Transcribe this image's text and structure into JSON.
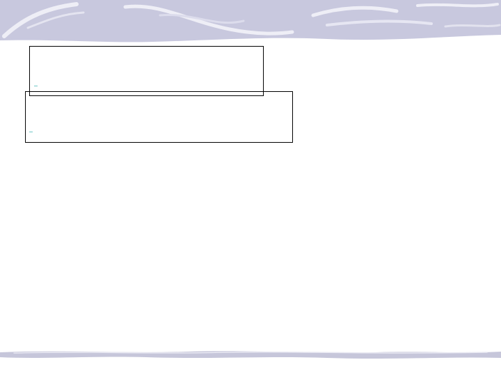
{
  "slide": {
    "banner_color": "#c9c9df",
    "banner_swirl_color": "#eeeef6",
    "footer_color": "#c6c6da",
    "boxes": [
      {
        "text": ""
      },
      {
        "text": ""
      }
    ]
  }
}
